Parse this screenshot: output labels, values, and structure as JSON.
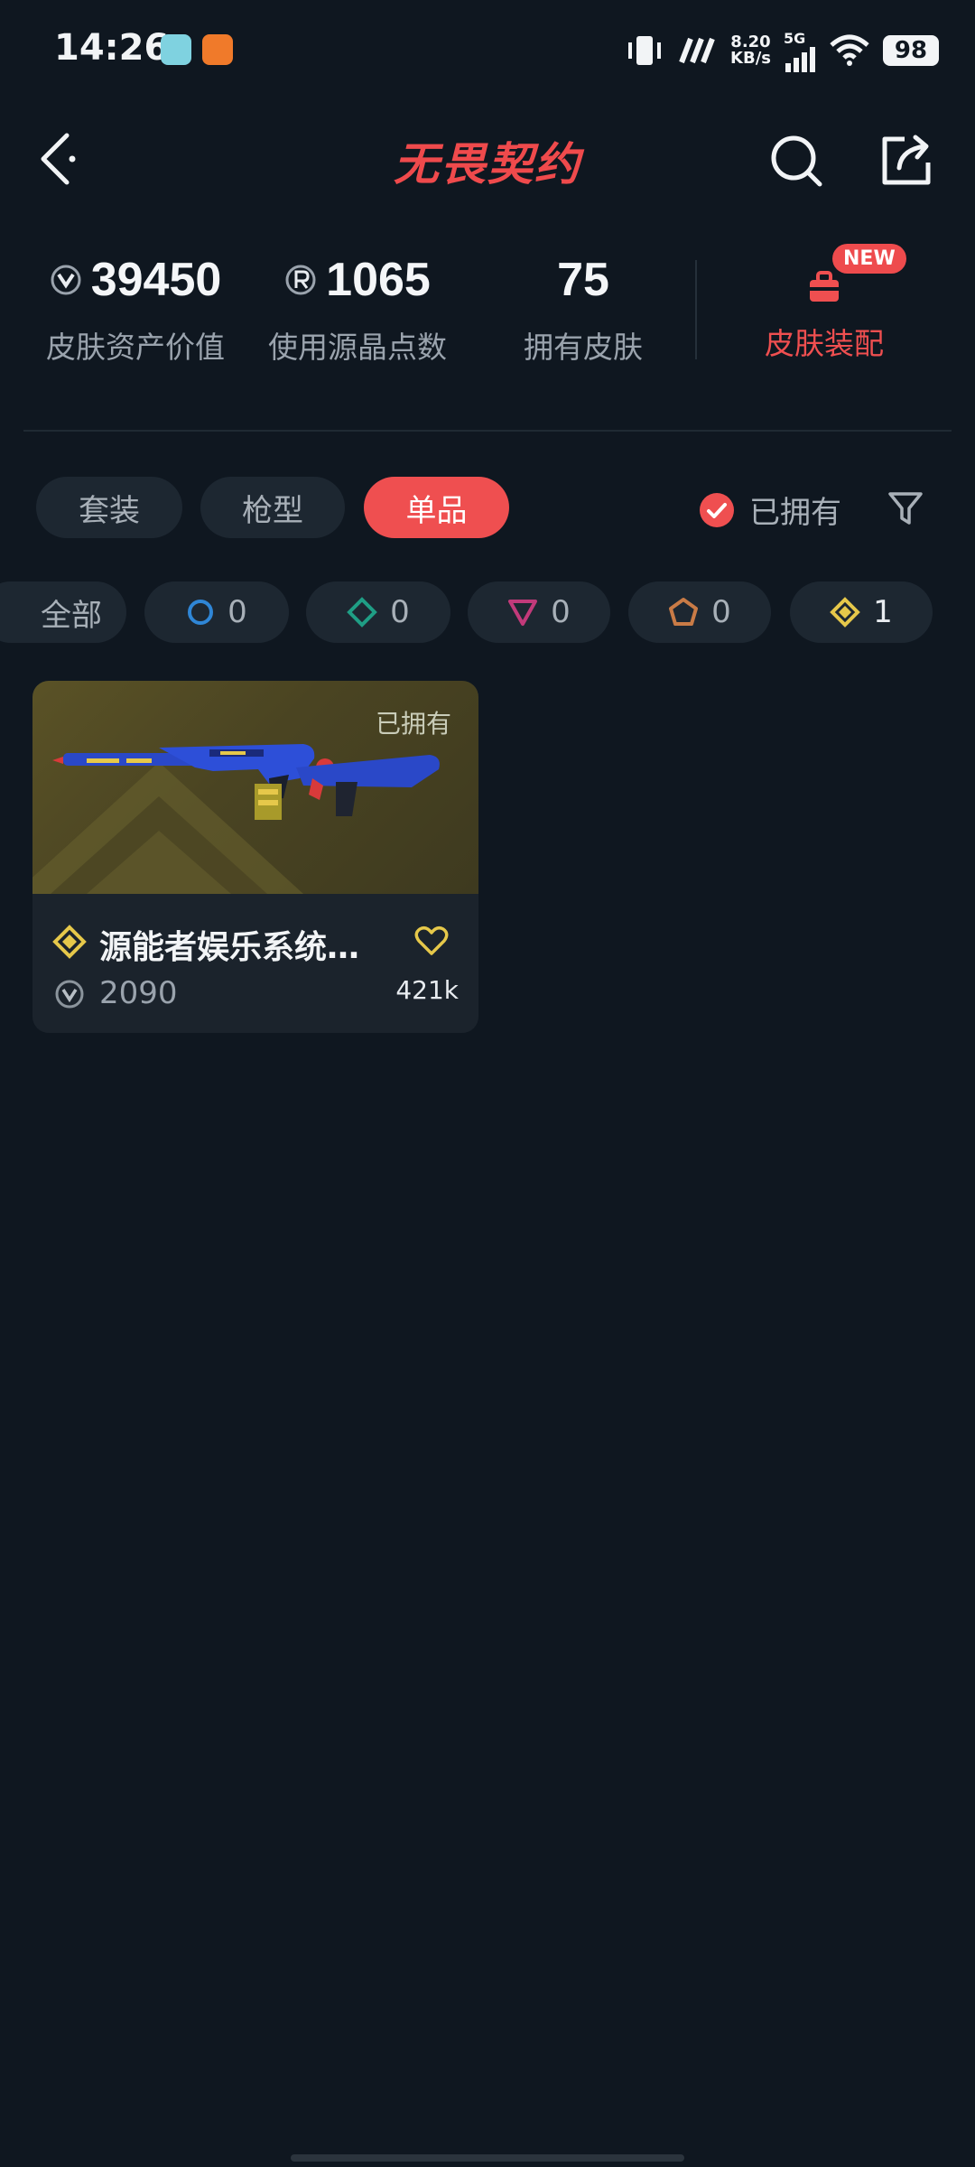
{
  "status_bar": {
    "time": "14:26",
    "net_speed_value": "8.20",
    "net_speed_unit": "KB/s",
    "network": "5G",
    "battery": "98"
  },
  "header": {
    "title": "无畏契约",
    "icons": [
      "back-icon",
      "search-icon",
      "share-icon"
    ]
  },
  "stats": [
    {
      "value": "39450",
      "label": "皮肤资产价值",
      "icon": "vp-icon"
    },
    {
      "value": "1065",
      "label": "使用源晶点数",
      "icon": "radianite-icon"
    },
    {
      "value": "75",
      "label": "拥有皮肤"
    }
  ],
  "loadout": {
    "label": "皮肤装配",
    "badge": "NEW",
    "icon": "loadout-icon"
  },
  "tabs": [
    {
      "label": "套装",
      "active": false
    },
    {
      "label": "枪型",
      "active": false
    },
    {
      "label": "单品",
      "active": true
    }
  ],
  "owned_filter": {
    "label": "已拥有",
    "checked": true
  },
  "rarity_chips": [
    {
      "label": "全部"
    },
    {
      "count": "0",
      "tier": "select",
      "color": "#2f86d6"
    },
    {
      "count": "0",
      "tier": "deluxe",
      "color": "#1f9e85"
    },
    {
      "count": "0",
      "tier": "premium",
      "color": "#c23a7a"
    },
    {
      "count": "0",
      "tier": "exclusive",
      "color": "#c97b46"
    },
    {
      "count": "1",
      "tier": "ultra",
      "color": "#e6c84a"
    }
  ],
  "skins": [
    {
      "name": "源能者娱乐系统…",
      "owned_label": "已拥有",
      "price": "2090",
      "likes": "421k",
      "rarity_color": "#e6c84a"
    }
  ],
  "colors": {
    "background": "#0f1720",
    "accent": "#ef4f50",
    "chip_bg": "#1d2731",
    "muted_text": "#9aa3ad"
  }
}
